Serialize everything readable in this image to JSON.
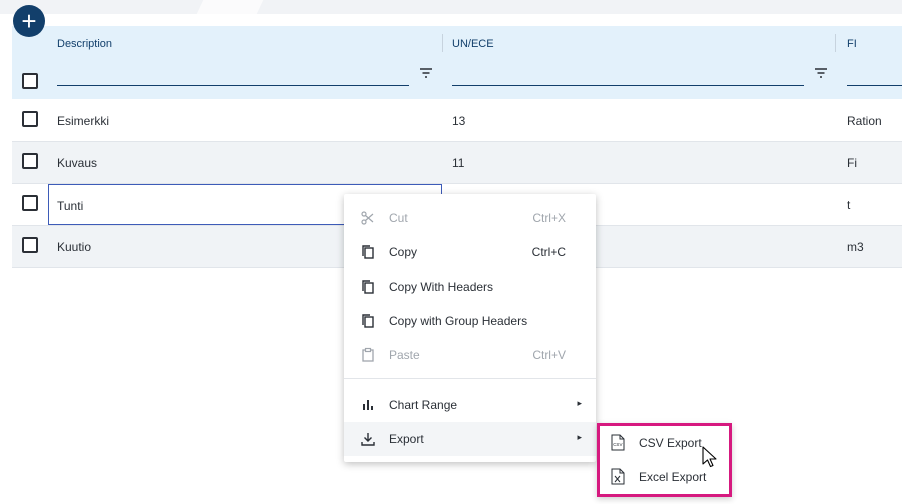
{
  "grid": {
    "columns": [
      {
        "title": "Description"
      },
      {
        "title": "UN/ECE"
      },
      {
        "title": "FI"
      }
    ],
    "rows": [
      {
        "description": "Esimerkki",
        "unece": "13",
        "fi": "Ration"
      },
      {
        "description": "Kuvaus",
        "unece": "11",
        "fi": "Fi"
      },
      {
        "description": "Tunti",
        "unece": "",
        "fi": "t"
      },
      {
        "description": "Kuutio",
        "unece": "",
        "fi": "m3"
      }
    ]
  },
  "add_button": {
    "label": "+"
  },
  "context_menu": {
    "items": [
      {
        "label": "Cut",
        "shortcut": "Ctrl+X",
        "icon": "scissors-icon",
        "disabled": true
      },
      {
        "label": "Copy",
        "shortcut": "Ctrl+C",
        "icon": "copy-icon",
        "disabled": false
      },
      {
        "label": "Copy With Headers",
        "shortcut": "",
        "icon": "copy-icon",
        "disabled": false
      },
      {
        "label": "Copy with Group Headers",
        "shortcut": "",
        "icon": "copy-icon",
        "disabled": false
      },
      {
        "label": "Paste",
        "shortcut": "Ctrl+V",
        "icon": "clipboard-icon",
        "disabled": true
      },
      {
        "label": "Chart Range",
        "shortcut": "",
        "icon": "bar-chart-icon",
        "disabled": false
      },
      {
        "label": "Export",
        "shortcut": "",
        "icon": "download-icon",
        "disabled": false
      }
    ],
    "submenu_arrow": "▸",
    "export_submenu": [
      {
        "label": "CSV Export",
        "icon": "csv-file-icon"
      },
      {
        "label": "Excel Export",
        "icon": "excel-file-icon"
      }
    ]
  },
  "colors": {
    "header_bg": "#e3f1fb",
    "accent": "#123f6b",
    "highlight": "#d6197f"
  }
}
